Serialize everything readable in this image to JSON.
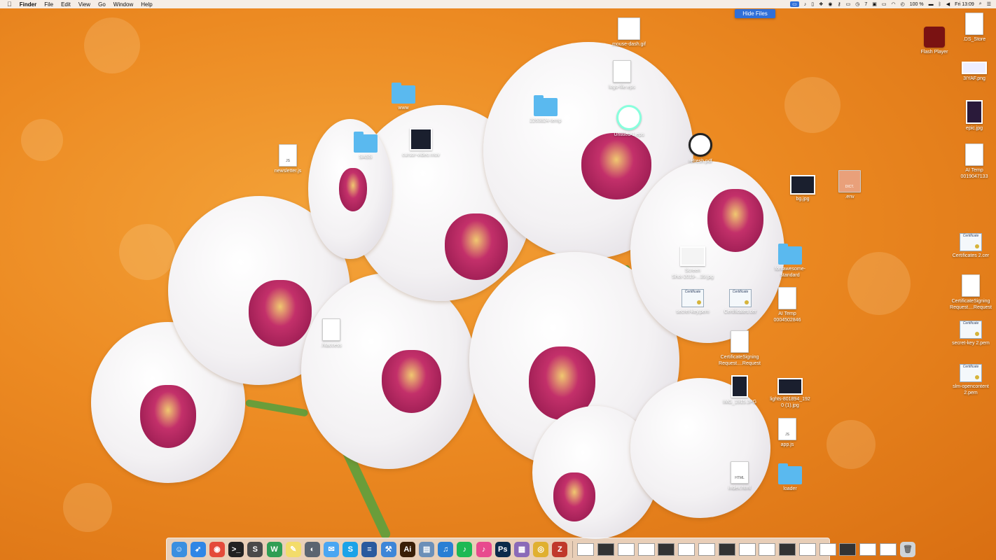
{
  "menubar": {
    "apple": "",
    "app_name": "Finder",
    "menus": [
      "File",
      "Edit",
      "View",
      "Go",
      "Window",
      "Help"
    ],
    "status": {
      "spaces_count": "7",
      "battery": "100 %",
      "clock": "Fri 13:09"
    }
  },
  "popup": {
    "hide_files": "Hide Files"
  },
  "desktop_icons": {
    "mouse_dash": "mouse-dash.gif",
    "logo_file": "logo-file.eps",
    "www": "www",
    "folder_2263": "2263824-temp",
    "untitled": "Untitled-1.eps",
    "sass": "SASS",
    "cursor_video": "cursor-video.mov",
    "refresh": "refresh.pdf",
    "newsletter": "newsletter.js",
    "bg": "bg.jpg",
    "env": ".env",
    "flash": "Flash Player",
    "ds_store": ".DS_Store",
    "yaf": "3IYAF.png",
    "epic": "epic.jpg",
    "ai_temp_1": "AI Temp\n0019047133",
    "fontawesome": "fontawesome-\nstandard",
    "screen_shot": "Screen\nShot-2019-...39.jpg",
    "secret_key": "secret-key.pem",
    "certificates": "Certificates.cer",
    "ai_temp_2": "AI Temp\n0004502846",
    "htaccess": ".htaccess",
    "csr": "CertificateSigning\nRequest....Request",
    "img_1915": "IMG_1915.JPG",
    "lights": "lights-801894_192\n0 (1).jpg",
    "app_js": "app.js",
    "index_html": "index.html",
    "loader": "loader",
    "certs_2": "Certificates 2.cer",
    "csr_2": "CertificateSigning\nRequest....Request",
    "secret_key_2": "secret-key 2.pem",
    "slm": "slm-opencontent\n2.pem"
  },
  "doc_tags": {
    "js": "JS",
    "html": "HTML",
    "dict": "DICT.",
    "cert": "Certificate"
  },
  "dock": {
    "apps": [
      {
        "name": "finder",
        "glyph": "☺",
        "color": "#3a8fe0"
      },
      {
        "name": "safari",
        "glyph": "➶",
        "color": "#2f86e6"
      },
      {
        "name": "chrome",
        "glyph": "◉",
        "color": "#e44a3a"
      },
      {
        "name": "terminal",
        "glyph": ">_",
        "color": "#222"
      },
      {
        "name": "sublime",
        "glyph": "S",
        "color": "#4a4a4a"
      },
      {
        "name": "wunderlist",
        "glyph": "W",
        "color": "#2f9e54"
      },
      {
        "name": "notes",
        "glyph": "✎",
        "color": "#f3dc6a"
      },
      {
        "name": "sequel",
        "glyph": "◐",
        "color": "#5b6470"
      },
      {
        "name": "messages",
        "glyph": "✉",
        "color": "#4aa6f2"
      },
      {
        "name": "skype",
        "glyph": "S",
        "color": "#1ba3e8"
      },
      {
        "name": "database",
        "glyph": "≡",
        "color": "#2a5a9e"
      },
      {
        "name": "xcode",
        "glyph": "⚒",
        "color": "#3e86d8"
      },
      {
        "name": "illustrator",
        "glyph": "Ai",
        "color": "#3a1f07"
      },
      {
        "name": "preview",
        "glyph": "▤",
        "color": "#6c8fb8"
      },
      {
        "name": "itunes-connect",
        "glyph": "♫",
        "color": "#2a7fd4"
      },
      {
        "name": "spotify",
        "glyph": "♪",
        "color": "#1db954"
      },
      {
        "name": "itunes",
        "glyph": "♪",
        "color": "#e84a8e"
      },
      {
        "name": "photoshop",
        "glyph": "Ps",
        "color": "#0a2a4a"
      },
      {
        "name": "archive",
        "glyph": "▦",
        "color": "#8a6ab8"
      },
      {
        "name": "coins",
        "glyph": "◎",
        "color": "#e0b030"
      },
      {
        "name": "filezilla",
        "glyph": "Z",
        "color": "#c0392b"
      }
    ],
    "minimized_count": 16
  },
  "colors": {
    "accent": "#2f6fd8",
    "folder": "#5ab9ef",
    "wallpaper": "#ec8a22"
  }
}
